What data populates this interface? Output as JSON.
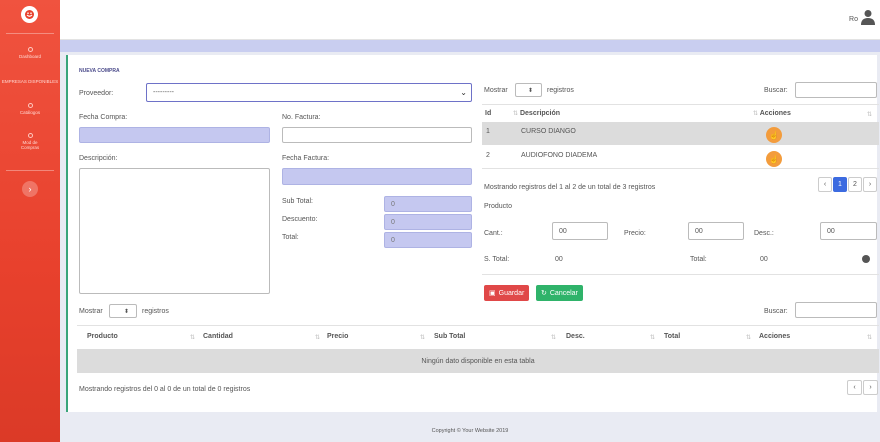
{
  "sidebar": {
    "items": [
      {
        "label": "Dashboard",
        "icon": "dashboard-icon"
      },
      {
        "label": "EMPRESAS DISPONIBLES",
        "icon": "building-icon"
      },
      {
        "label": "Catálogos",
        "icon": "catalog-icon"
      },
      {
        "label": "Mod de Compras",
        "icon": "cart-icon"
      }
    ],
    "toggle": "›"
  },
  "topbar": {
    "user": "Ro"
  },
  "form": {
    "title": "NUEVA COMPRA",
    "proveedor_label": "Proveedor:",
    "proveedor_value": "---------",
    "fecha_compra_label": "Fecha Compra:",
    "no_factura_label": "No. Factura:",
    "descripcion_label": "Descripción:",
    "fecha_factura_label": "Fecha Factura:",
    "subtotal_label": "Sub Total:",
    "subtotal_value": "0",
    "descuento_label": "Descuento:",
    "descuento_value": "0",
    "total_label": "Total:",
    "total_value": "0"
  },
  "products": {
    "mostrar_label": "Mostrar",
    "mostrar_value": "",
    "registros_label": "registros",
    "buscar_label": "Buscar:",
    "columns": [
      "Id",
      "Descripción",
      "Acciones"
    ],
    "rows": [
      {
        "id": "1",
        "descripcion": "CURSO DIANGO"
      },
      {
        "id": "2",
        "descripcion": "AUDIOFONO DIADEMA"
      }
    ],
    "info": "Mostrando registros del 1 al 2 de un total de 3 registros",
    "pages": [
      "‹",
      "1",
      "2",
      "›"
    ],
    "producto_label": "Producto",
    "cant_label": "Cant.:",
    "cant_value": "00",
    "precio_label": "Precio:",
    "precio_value": "00",
    "desc_label": "Desc.:",
    "desc_value": "00",
    "stotal_label": "S. Total:",
    "stotal_value": "00",
    "total_label": "Total:",
    "total_value": "00",
    "guardar": "Guardar",
    "cancelar": "Cancelar"
  },
  "detail": {
    "mostrar_label": "Mostrar",
    "registros_label": "registros",
    "buscar_label": "Buscar:",
    "columns": [
      "Producto",
      "Cantidad",
      "Precio",
      "Sub Total",
      "Desc.",
      "Total",
      "Acciones"
    ],
    "empty": "Ningún dato disponible en esta tabla",
    "info": "Mostrando registros del 0 al 0 de un total de 0 registros",
    "pages": [
      "‹",
      "›"
    ]
  },
  "footer": "Copyright © Your Website 2019",
  "colors": {
    "sidebar": "#e8412d",
    "accent": "#3c6be0",
    "orange": "#f39c3c",
    "guardar": "#e04848",
    "cancelar": "#2fb36a"
  }
}
